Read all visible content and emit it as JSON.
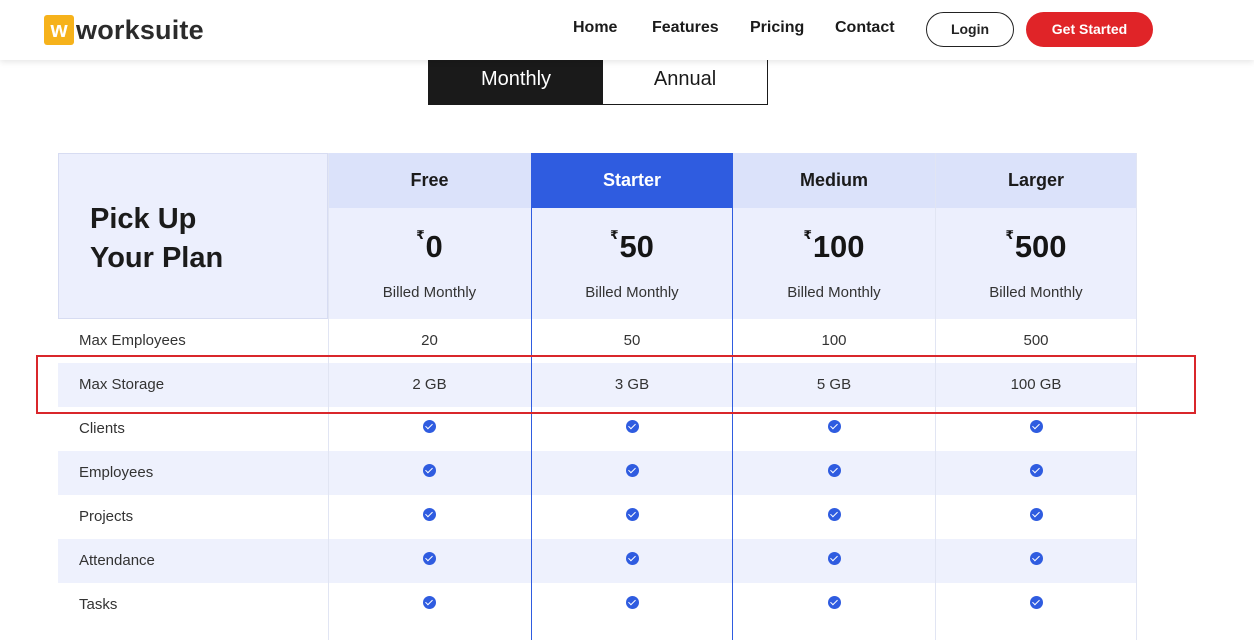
{
  "header": {
    "logo_mark": "w",
    "logo_text": "worksuite",
    "nav": [
      "Home",
      "Features",
      "Pricing",
      "Contact"
    ],
    "login_label": "Login",
    "get_started_label": "Get Started"
  },
  "billing_toggle": {
    "options": [
      "Monthly",
      "Annual"
    ],
    "selected": "Monthly"
  },
  "pricing": {
    "title_line1": "Pick Up",
    "title_line2": "Your Plan",
    "currency_symbol": "₹",
    "featured_plan": "Starter",
    "plans": [
      {
        "name": "Free",
        "price": "0",
        "billing": "Billed Monthly"
      },
      {
        "name": "Starter",
        "price": "50",
        "billing": "Billed Monthly"
      },
      {
        "name": "Medium",
        "price": "100",
        "billing": "Billed Monthly"
      },
      {
        "name": "Larger",
        "price": "500",
        "billing": "Billed Monthly"
      }
    ],
    "features": [
      {
        "label": "Max Employees",
        "values": [
          "20",
          "50",
          "100",
          "500"
        ]
      },
      {
        "label": "Max Storage",
        "values": [
          "2 GB",
          "3 GB",
          "5 GB",
          "100 GB"
        ],
        "highlighted": true
      },
      {
        "label": "Clients",
        "values": [
          "check",
          "check",
          "check",
          "check"
        ]
      },
      {
        "label": "Employees",
        "values": [
          "check",
          "check",
          "check",
          "check"
        ]
      },
      {
        "label": "Projects",
        "values": [
          "check",
          "check",
          "check",
          "check"
        ]
      },
      {
        "label": "Attendance",
        "values": [
          "check",
          "check",
          "check",
          "check"
        ]
      },
      {
        "label": "Tasks",
        "values": [
          "check",
          "check",
          "check",
          "check"
        ]
      }
    ]
  },
  "colors": {
    "brand_yellow": "#f6b21b",
    "cta_red": "#e02428",
    "featured_blue": "#2f5ce0",
    "highlight_red": "#d9262b"
  },
  "icons": {
    "included": "check-circle-icon"
  }
}
